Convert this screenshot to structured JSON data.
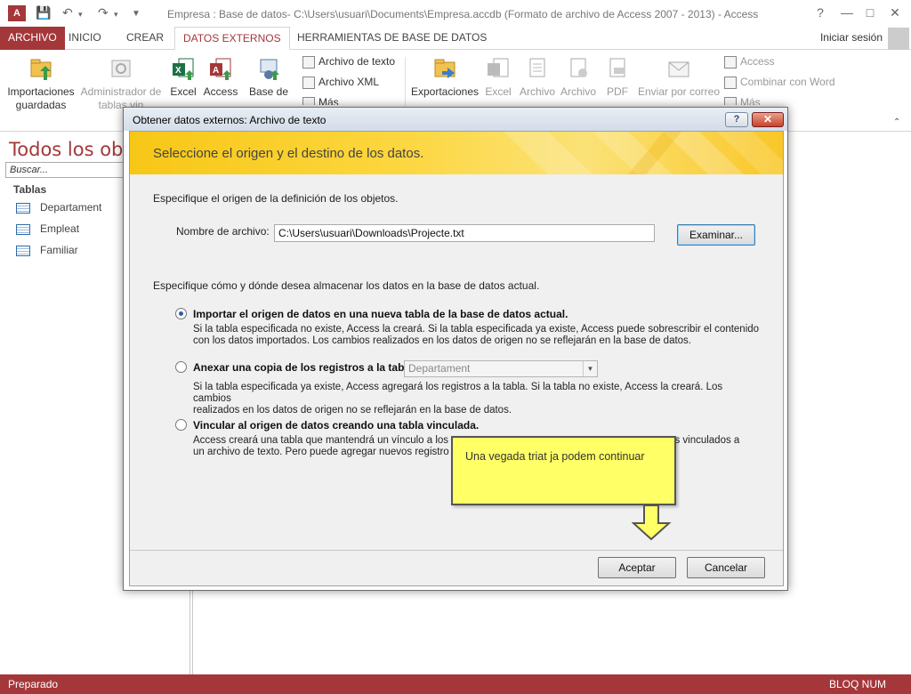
{
  "window": {
    "title": "Empresa : Base de datos- C:\\Users\\usuari\\Documents\\Empresa.accdb (Formato de archivo de Access 2007 - 2013) - Access",
    "logo_text": "A",
    "help_glyph": "?",
    "minimize_glyph": "—",
    "restore_glyph": "□",
    "close_glyph": "✕"
  },
  "tabs": {
    "file": "ARCHIVO",
    "home": "INICIO",
    "create": "CREAR",
    "external": "DATOS EXTERNOS",
    "tools": "HERRAMIENTAS DE BASE DE DATOS",
    "signin": "Iniciar sesión"
  },
  "ribbon": {
    "saved_imports_1": "Importaciones",
    "saved_imports_2": "guardadas",
    "linked_mgr_1": "Administrador de",
    "linked_mgr_2": "tablas vin",
    "excel": "Excel",
    "access": "Access",
    "odbc": "Base de",
    "text_file": "Archivo de texto",
    "xml_file": "Archivo XML",
    "more": "Más",
    "exports": "Exportaciones",
    "exp_excel": "Excel",
    "exp_file1": "Archivo",
    "exp_file2": "Archivo",
    "exp_pdf": "PDF",
    "email": "Enviar por correo",
    "exp_access": "Access",
    "word_merge": "Combinar con Word",
    "exp_more": "Más"
  },
  "nav": {
    "title": "Todos los obj",
    "search_placeholder": "Buscar...",
    "group": "Tablas",
    "items": [
      "Departament",
      "Empleat",
      "Familiar"
    ]
  },
  "status": {
    "left": "Preparado",
    "right": "BLOQ NUM"
  },
  "dialog": {
    "title": "Obtener datos externos: Archivo de texto",
    "help": "?",
    "close": "✕",
    "banner": "Seleccione el origen y el destino de los datos.",
    "source_heading": "Especifique el origen de la definición de los objetos.",
    "file_label": "Nombre de archivo:",
    "file_value": "C:\\Users\\usuari\\Downloads\\Projecte.txt",
    "browse": "Examinar...",
    "dest_heading": "Especifique cómo y dónde desea almacenar los datos en la base de datos actual.",
    "opt1_label": "Importar el origen de datos en una nueva tabla de la base de datos actual.",
    "opt1_desc_1": "Si la tabla especificada no existe, Access la creará. Si la tabla especificada ya existe, Access puede sobrescribir el contenido",
    "opt1_desc_2": "con los datos importados. Los cambios realizados en los datos de origen no se reflejarán en la base de datos.",
    "opt2_label": "Anexar una copia de los registros a la tabla:",
    "opt2_select": "Departament",
    "opt2_desc_1": "Si la tabla especificada ya existe, Access agregará los registros a la tabla. Si la tabla no existe, Access la creará. Los cambios",
    "opt2_desc_2": "realizados en los datos de origen no se reflejarán en la base de datos.",
    "opt3_label": "Vincular al origen de datos creando una tabla vinculada.",
    "opt3_desc_1a": "Access creará una tabla que mantendrá un vínculo a los",
    "opt3_desc_1b": "os vinculados a",
    "opt3_desc_2": "un archivo de texto. Pero puede agregar nuevos registro",
    "ok": "Aceptar",
    "cancel": "Cancelar"
  },
  "callout": {
    "text": "Una vegada triat ja podem continuar"
  },
  "colors": {
    "access_red": "#a4373a",
    "banner_yellow": "#f7c716",
    "callout_yellow": "#ffff66"
  }
}
